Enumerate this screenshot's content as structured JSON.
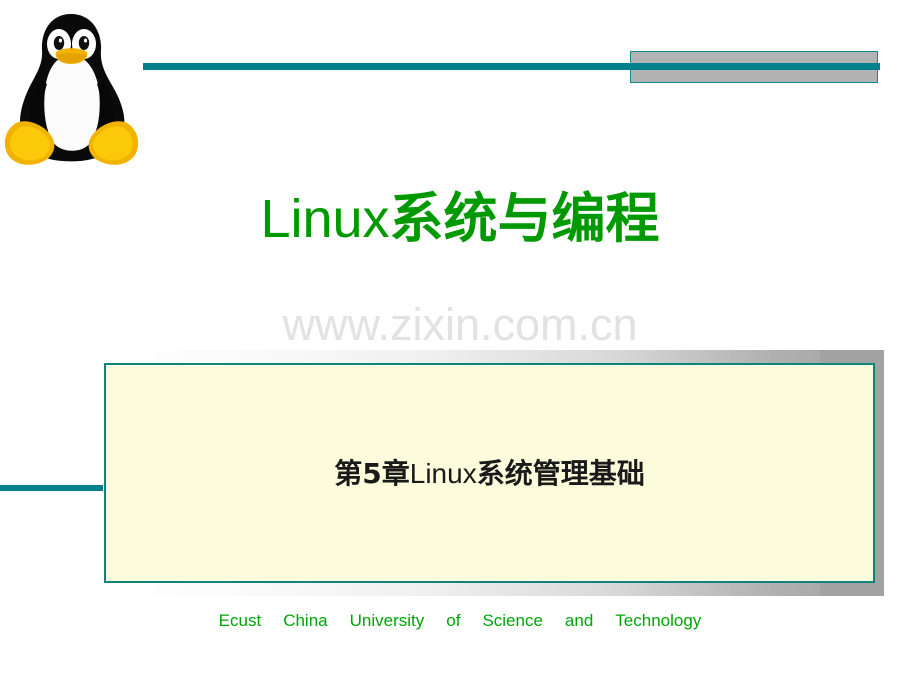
{
  "slide": {
    "title_latin": "Linux",
    "title_cjk": "系统与编程",
    "title_full": "Linux系统与编程",
    "watermark": "www.zixin.com.cn",
    "chapter_prefix_cjk": "第5章",
    "chapter_latin": "Linux",
    "chapter_suffix_cjk": "系统管理基础",
    "chapter_full": "第5章Linux系统管理基础",
    "logo_alt": "tux-penguin-logo"
  },
  "footer": {
    "words": [
      "Ecust",
      "China",
      "University",
      "of",
      "Science",
      "and",
      "Technology"
    ],
    "full": "Ecust China University of Science and Technology"
  },
  "colors": {
    "teal_rule": "#00808a",
    "teal_border": "#11837f",
    "title_green": "#009900",
    "footer_green": "#00a508",
    "panel_yellow": "#fcfcdc",
    "plate_grey": "#a2a2a2",
    "block_grey": "#b3b3b3",
    "watermark_grey": "#e2e2e2",
    "background": "#ffffff"
  }
}
